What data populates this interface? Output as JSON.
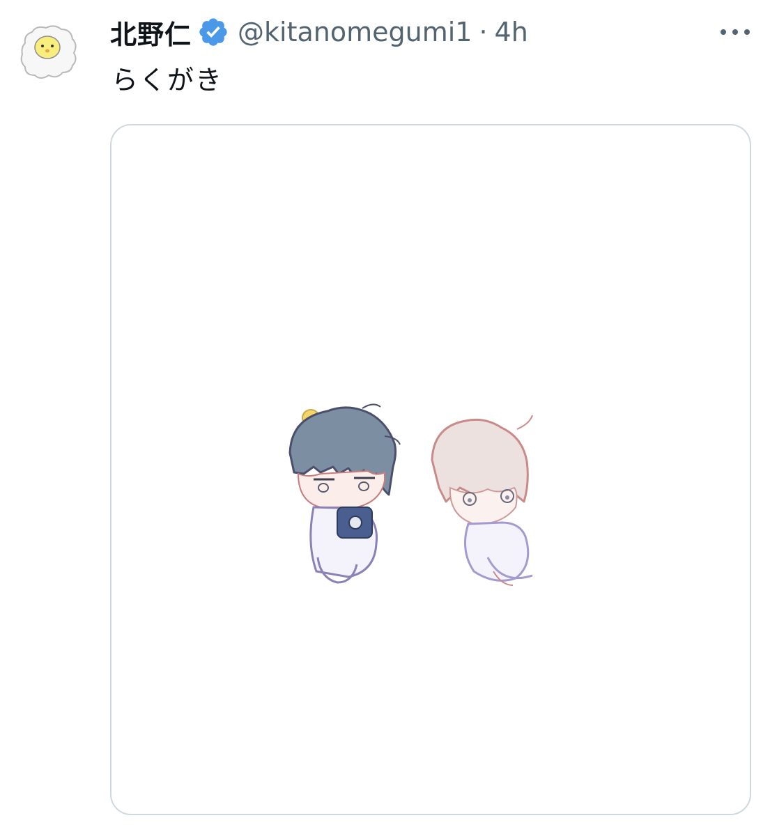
{
  "tweet": {
    "author": {
      "display_name": "北野仁",
      "handle": "@kitanomegumi1",
      "verified": true,
      "avatar_icon": "chick-doodle-avatar"
    },
    "separator": "·",
    "timestamp": "4h",
    "text": "らくがき",
    "more_icon": "more-horizontal-icon",
    "media": {
      "type": "image",
      "description_icon": "doodle-illustration"
    }
  },
  "colors": {
    "text_primary": "#0f1419",
    "text_secondary": "#536471",
    "verified_blue": "#4a99e9",
    "border": "#cfd9de"
  }
}
